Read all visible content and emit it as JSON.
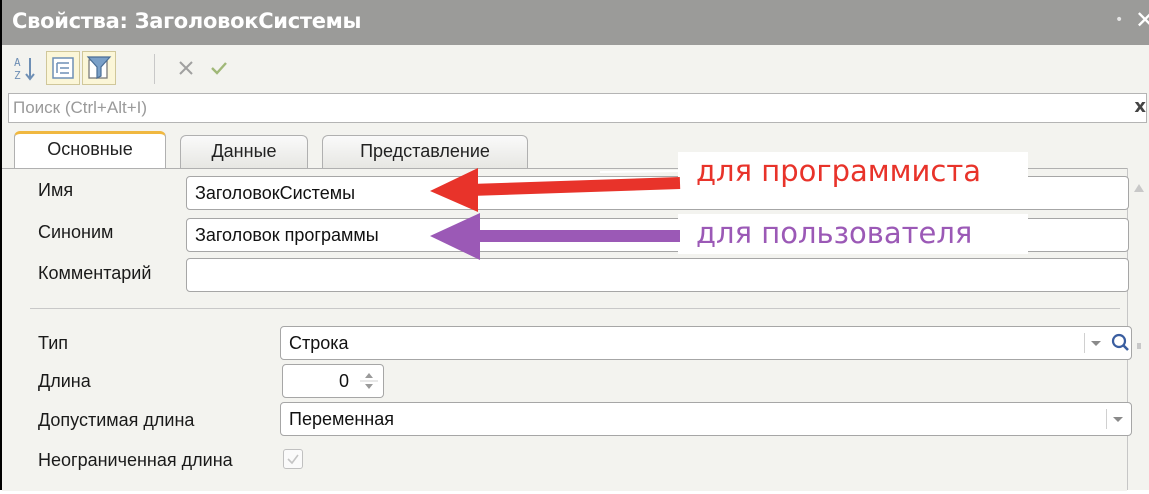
{
  "window": {
    "title": "Свойства: ЗаголовокСистемы",
    "pin_glyph": "•",
    "close_glyph": "✕"
  },
  "toolbar": {
    "items": [
      {
        "name": "sort-alpha-icon",
        "glyph": "A-Z"
      },
      {
        "name": "categorize-icon",
        "glyph": "tree"
      },
      {
        "name": "filter-icon",
        "glyph": "filter"
      },
      {
        "name": "cancel-icon",
        "glyph": "✕"
      },
      {
        "name": "apply-icon",
        "glyph": "✔"
      }
    ]
  },
  "search": {
    "placeholder": "Поиск (Ctrl+Alt+I)",
    "value": "",
    "clear_glyph": "x"
  },
  "tabs": [
    {
      "label": "Основные",
      "active": true
    },
    {
      "label": "Данные",
      "active": false
    },
    {
      "label": "Представление",
      "active": false
    }
  ],
  "form": {
    "name": {
      "label": "Имя",
      "value": "ЗаголовокСистемы"
    },
    "synonym": {
      "label": "Синоним",
      "value": "Заголовок программы"
    },
    "comment": {
      "label": "Комментарий",
      "value": ""
    },
    "type": {
      "label": "Тип",
      "value": "Строка"
    },
    "length": {
      "label": "Длина",
      "value": "0"
    },
    "allowed_length": {
      "label": "Допустимая длина",
      "value": "Переменная"
    },
    "unlimited_length": {
      "label": "Неограниченная длина",
      "checked": false
    }
  },
  "annotations": {
    "programmer": {
      "text": "для программиста",
      "color": "#e8332a"
    },
    "user": {
      "text": "для пользователя",
      "color": "#9b59b6"
    }
  },
  "colors": {
    "titlebar": "#9b9b99",
    "panel": "#f3f3ef",
    "tab_accent": "#f0b840"
  }
}
